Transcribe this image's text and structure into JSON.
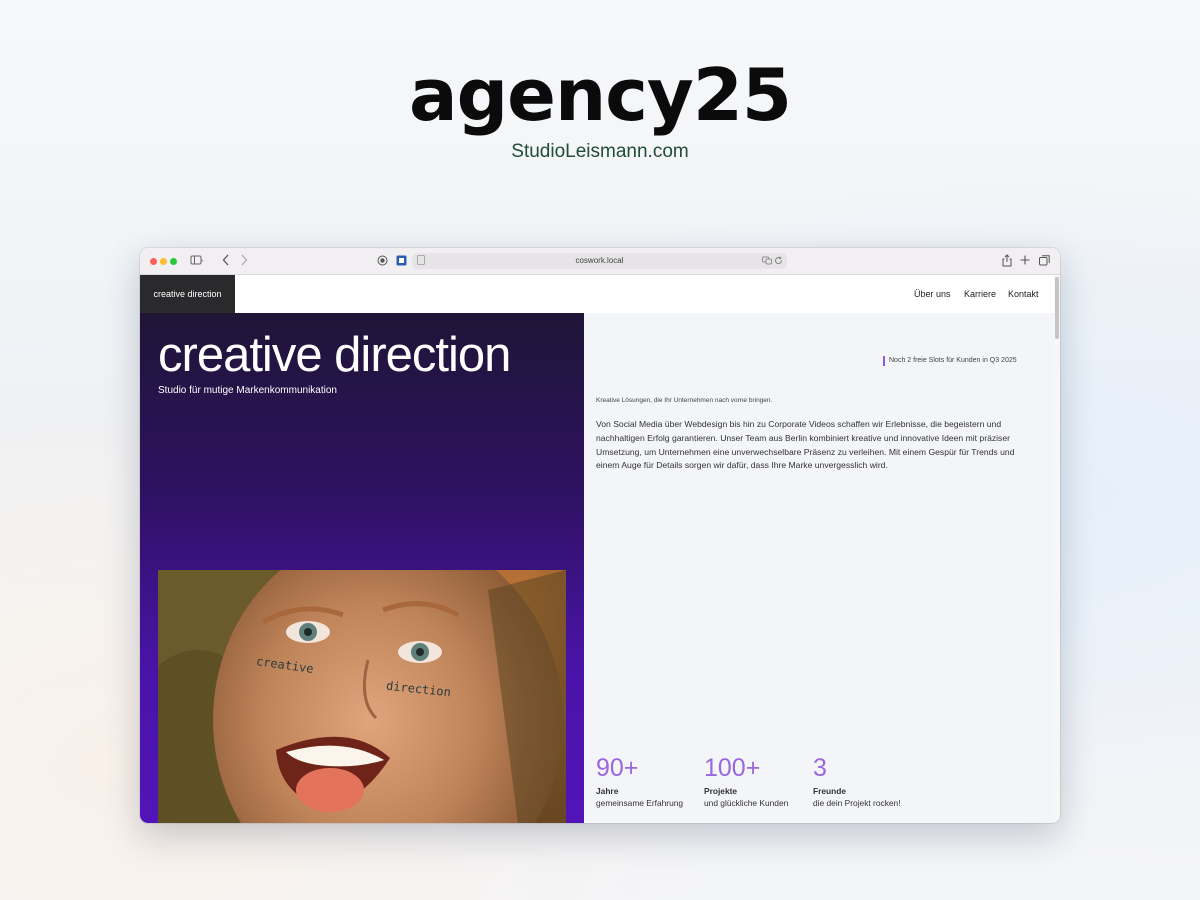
{
  "promo": {
    "title": "agency25",
    "subtitle": "StudioLeismann.com"
  },
  "browser": {
    "url": "coswork.local",
    "icons": [
      "sidebar-icon",
      "chevron-back-icon",
      "chevron-forward-icon",
      "privacy-icon",
      "extension-icon",
      "page-icon",
      "translate-icon",
      "reload-icon",
      "share-icon",
      "new-tab-icon",
      "tabs-overview-icon"
    ]
  },
  "nav": {
    "brand": "creative direction",
    "links": [
      "Über uns",
      "Karriere",
      "Kontakt"
    ]
  },
  "hero": {
    "title": "creative direction",
    "subtitle": "Studio für mutige Markenkommunikation",
    "photo_text_1": "creative",
    "photo_text_2": "direction"
  },
  "content": {
    "slots_note": "Noch 2 freie Slots für Kunden in Q3 2025",
    "tagline": "Kreative Lösungen, die Ihr Unternehmen nach vorne bringen.",
    "body": "Von Social Media über Webdesign bis hin zu Corporate Videos schaffen wir Erlebnisse, die begeistern und nachhaltigen Erfolg garantieren. Unser Team aus Berlin kombiniert kreative und innovative Ideen mit präziser Umsetzung, um Unternehmen eine unverwechselbare Präsenz zu verleihen. Mit einem Gespür für Trends und einem Auge für Details sorgen wir dafür, dass Ihre Marke unvergesslich wird."
  },
  "stats": [
    {
      "number": "90+",
      "label": "Jahre",
      "description": "gemeinsame Erfahrung"
    },
    {
      "number": "100+",
      "label": "Projekte",
      "description": "und glückliche Kunden"
    },
    {
      "number": "3",
      "label": "Freunde",
      "description": "die dein Projekt rocken!"
    }
  ],
  "colors": {
    "accent_purple": "#9a67dc",
    "hero_gradient_end": "#5214b8",
    "brand_box": "#2a2a2c",
    "subtitle_green": "#1f4d36"
  }
}
